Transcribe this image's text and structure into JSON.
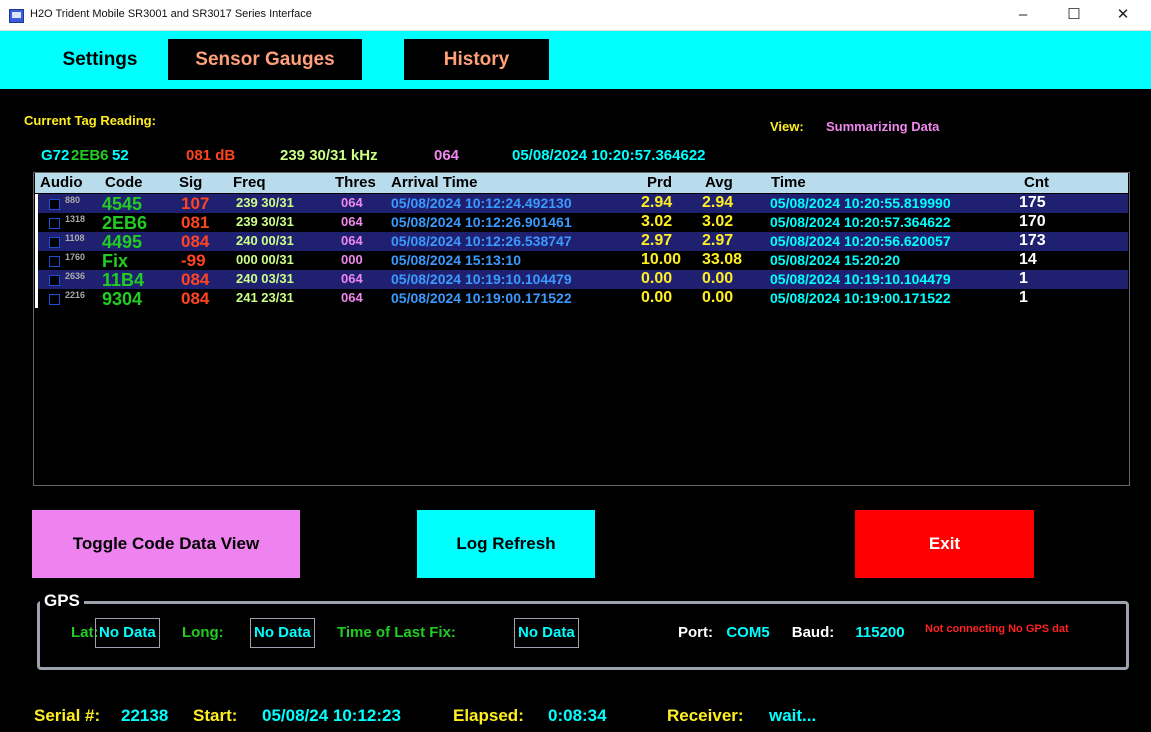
{
  "window": {
    "title": "H2O Trident Mobile SR3001 and SR3017 Series Interface",
    "minimize": "–",
    "maximize": "☐",
    "close": "✕"
  },
  "tabs": {
    "settings": "Settings",
    "sensor_gauges": "Sensor Gauges",
    "history": "History"
  },
  "current": {
    "label": "Current Tag Reading:",
    "code_prefix": "G72",
    "code": "2EB6",
    "code_suffix": "52",
    "sig": "081 dB",
    "freq": "239 30/31 kHz",
    "thres": "064",
    "time": "05/08/2024 10:20:57.364622"
  },
  "view": {
    "label": "View:",
    "value": "Summarizing Data"
  },
  "table": {
    "headers": {
      "audio": "Audio",
      "code": "Code",
      "sig": "Sig",
      "freq": "Freq",
      "thres": "Thres",
      "arrival": "Arrival Time",
      "prd": "Prd",
      "avg": "Avg",
      "time": "Time",
      "cnt": "Cnt"
    },
    "rows": [
      {
        "num": "880",
        "code": "4545",
        "sig": "107",
        "freq": "239 30/31",
        "thres": "064",
        "arrival": "05/08/2024 10:12:24.492130",
        "prd": "2.94",
        "avg": "2.94",
        "time": "05/08/2024 10:20:55.819990",
        "cnt": "175"
      },
      {
        "num": "1318",
        "code": "2EB6",
        "sig": "081",
        "freq": "239 30/31",
        "thres": "064",
        "arrival": "05/08/2024 10:12:26.901461",
        "prd": "3.02",
        "avg": "3.02",
        "time": "05/08/2024 10:20:57.364622",
        "cnt": "170"
      },
      {
        "num": "1108",
        "code": "4495",
        "sig": "084",
        "freq": "240 00/31",
        "thres": "064",
        "arrival": "05/08/2024 10:12:26.538747",
        "prd": "2.97",
        "avg": "2.97",
        "time": "05/08/2024 10:20:56.620057",
        "cnt": "173"
      },
      {
        "num": "1760",
        "code": "Fix",
        "sig": "-99",
        "freq": "000 00/31",
        "thres": "000",
        "arrival": "05/08/2024 15:13:10",
        "prd": "10.00",
        "avg": "33.08",
        "time": "05/08/2024 15:20:20",
        "cnt": "14"
      },
      {
        "num": "2636",
        "code": "11B4",
        "sig": "084",
        "freq": "240 03/31",
        "thres": "064",
        "arrival": "05/08/2024 10:19:10.104479",
        "prd": "0.00",
        "avg": "0.00",
        "time": "05/08/2024 10:19:10.104479",
        "cnt": "1"
      },
      {
        "num": "2216",
        "code": "9304",
        "sig": "084",
        "freq": "241 23/31",
        "thres": "064",
        "arrival": "05/08/2024 10:19:00.171522",
        "prd": "0.00",
        "avg": "0.00",
        "time": "05/08/2024 10:19:00.171522",
        "cnt": "1"
      }
    ]
  },
  "buttons": {
    "toggle": "Toggle Code Data View",
    "log_refresh": "Log Refresh",
    "exit": "Exit"
  },
  "gps": {
    "title": "GPS",
    "lat_label": "Lat:",
    "lat_value": "No Data",
    "long_label": "Long:",
    "long_value": "No Data",
    "fix_label": "Time of Last Fix:",
    "fix_value": "No Data",
    "port_label": "Port:",
    "port_value": "COM5",
    "baud_label": "Baud:",
    "baud_value": "115200",
    "status": "Not connecting  No GPS dat"
  },
  "footer": {
    "serial_label": "Serial #:",
    "serial": "22138",
    "start_label": "Start:",
    "start": "05/08/24 10:12:23",
    "elapsed_label": "Elapsed:",
    "elapsed": "0:08:34",
    "receiver_label": "Receiver:",
    "receiver": "wait..."
  },
  "colors": {
    "cyan": "#00ffff",
    "row_band": "#202070",
    "green": "#22cc22",
    "orange": "#ff4422",
    "yellow": "#ffee22",
    "pink": "#ee88ee",
    "blue": "#3a9aff",
    "exit_red": "#ff0000"
  }
}
